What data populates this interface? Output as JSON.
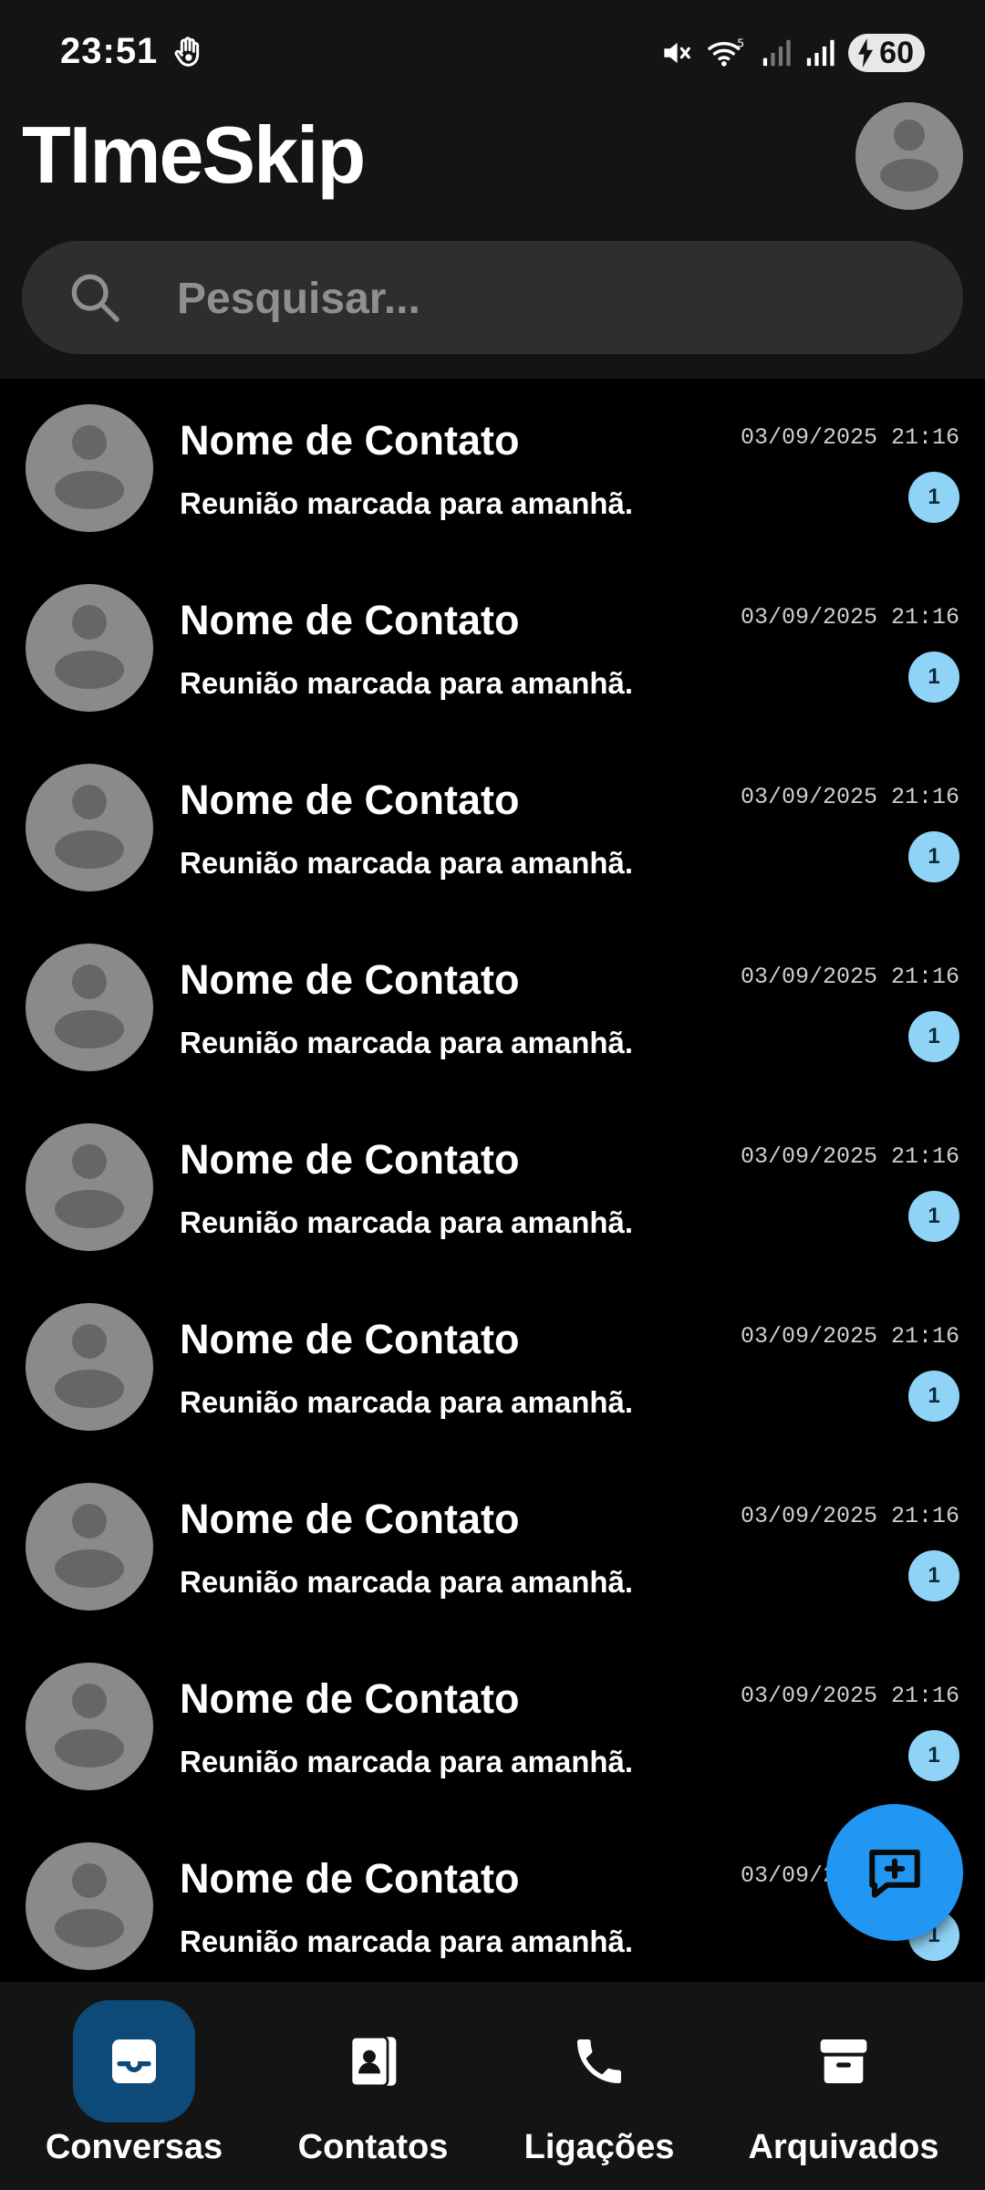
{
  "status_bar": {
    "time": "23:51",
    "battery_level": "60",
    "icons": [
      "hand-icon",
      "mute-icon",
      "wifi-icon",
      "signal-icon",
      "signal-icon",
      "battery-charging-icon"
    ]
  },
  "header": {
    "title": "TImeSkip"
  },
  "search": {
    "placeholder": "Pesquisar..."
  },
  "conversations": [
    {
      "name": "Nome de Contato",
      "message": "Reunião marcada para amanhã.",
      "time": "03/09/2025 21:16",
      "unread": "1"
    },
    {
      "name": "Nome de Contato",
      "message": "Reunião marcada para amanhã.",
      "time": "03/09/2025 21:16",
      "unread": "1"
    },
    {
      "name": "Nome de Contato",
      "message": "Reunião marcada para amanhã.",
      "time": "03/09/2025 21:16",
      "unread": "1"
    },
    {
      "name": "Nome de Contato",
      "message": "Reunião marcada para amanhã.",
      "time": "03/09/2025 21:16",
      "unread": "1"
    },
    {
      "name": "Nome de Contato",
      "message": "Reunião marcada para amanhã.",
      "time": "03/09/2025 21:16",
      "unread": "1"
    },
    {
      "name": "Nome de Contato",
      "message": "Reunião marcada para amanhã.",
      "time": "03/09/2025 21:16",
      "unread": "1"
    },
    {
      "name": "Nome de Contato",
      "message": "Reunião marcada para amanhã.",
      "time": "03/09/2025 21:16",
      "unread": "1"
    },
    {
      "name": "Nome de Contato",
      "message": "Reunião marcada para amanhã.",
      "time": "03/09/2025 21:16",
      "unread": "1"
    },
    {
      "name": "Nome de Contato",
      "message": "Reunião marcada para amanhã.",
      "time": "03/09/2025 21:16",
      "unread": "1"
    }
  ],
  "bottom_nav": {
    "items": [
      {
        "label": "Conversas",
        "icon": "inbox-icon",
        "active": true
      },
      {
        "label": "Contatos",
        "icon": "contacts-icon",
        "active": false
      },
      {
        "label": "Ligações",
        "icon": "phone-icon",
        "active": false
      },
      {
        "label": "Arquivados",
        "icon": "archive-icon",
        "active": false
      }
    ]
  },
  "colors": {
    "background": "#000000",
    "header": "#141414",
    "accent": "#2196f3",
    "badge": "#8fd3f7",
    "active_nav": "#0d4a78"
  }
}
